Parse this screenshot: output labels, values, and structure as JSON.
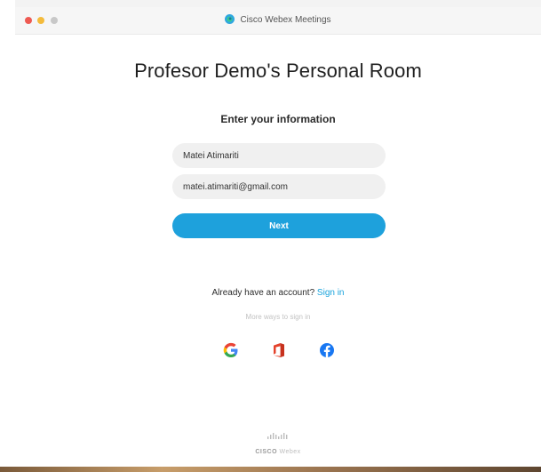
{
  "window": {
    "app_title": "Cisco Webex Meetings",
    "icon": "webex-icon",
    "traffic_lights": {
      "close": "#ee5a52",
      "minimize": "#f4bb3c",
      "maximize": "#c8c8c8"
    }
  },
  "main": {
    "page_title": "Profesor Demo's Personal Room",
    "section_label": "Enter your information",
    "name_field": {
      "value": "Matei Atimariti"
    },
    "email_field": {
      "value": "matei.atimariti@gmail.com"
    },
    "next_label": "Next",
    "account_prompt": "Already have an account?",
    "sign_in_label": "Sign in",
    "more_ways_label": "More ways to sign in",
    "social": [
      {
        "name": "google-icon",
        "color": "#ea4335"
      },
      {
        "name": "office-icon",
        "color": "#e4422b"
      },
      {
        "name": "facebook-icon",
        "color": "#1877f2"
      }
    ]
  },
  "footer": {
    "brand_cisco": "CISCO",
    "brand_product": "Webex"
  },
  "colors": {
    "accent": "#1ea1dc",
    "link": "#1aa3dc",
    "field_bg": "#f0f0f0"
  }
}
